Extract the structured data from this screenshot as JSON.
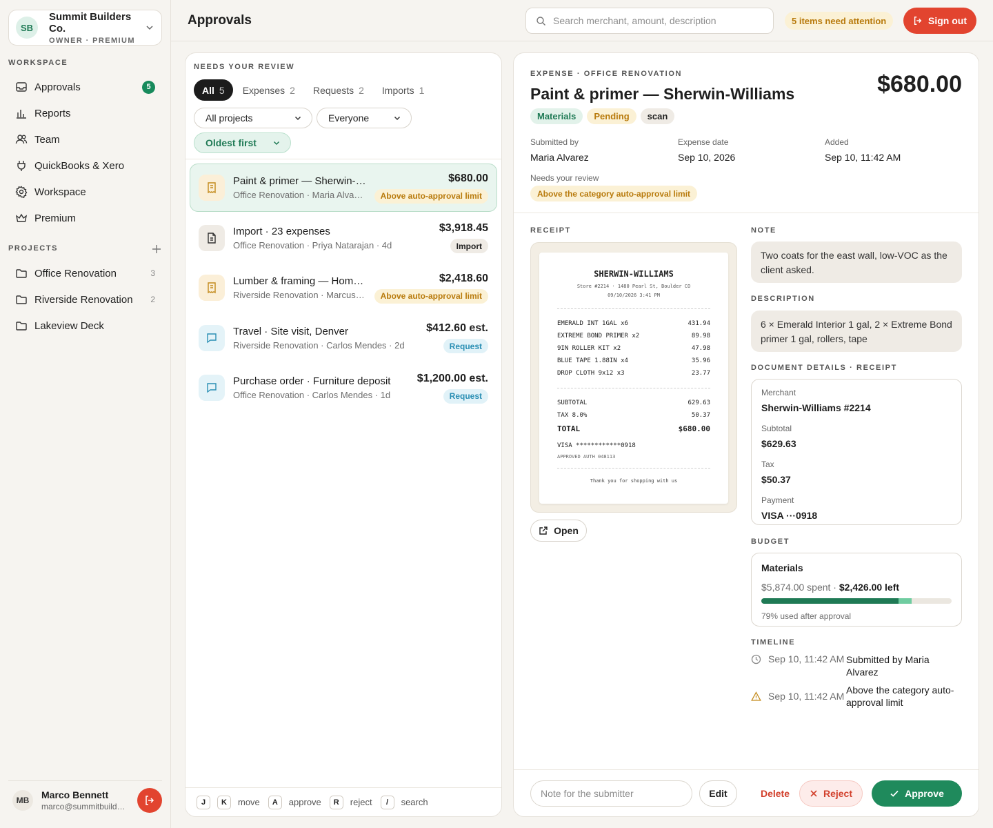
{
  "org": {
    "initials": "SB",
    "name": "Summit Builders Co.",
    "sub": "OWNER · PREMIUM"
  },
  "sidebar": {
    "workspace_label": "WORKSPACE",
    "items": [
      {
        "label": "Approvals",
        "icon": "inbox-icon",
        "badge": "5"
      },
      {
        "label": "Reports",
        "icon": "bar-chart-icon"
      },
      {
        "label": "Team",
        "icon": "users-icon"
      },
      {
        "label": "QuickBooks & Xero",
        "icon": "plug-icon"
      },
      {
        "label": "Workspace",
        "icon": "gear-icon"
      },
      {
        "label": "Premium",
        "icon": "crown-icon"
      }
    ],
    "projects_label": "PROJECTS",
    "projects": [
      {
        "label": "Office Renovation",
        "count": "3"
      },
      {
        "label": "Riverside Renovation",
        "count": "2"
      },
      {
        "label": "Lakeview Deck",
        "count": ""
      }
    ]
  },
  "user": {
    "initials": "MB",
    "name": "Marco Bennett",
    "email": "marco@summitbuilders.co"
  },
  "header": {
    "title": "Approvals",
    "search_placeholder": "Search merchant, amount, description",
    "attention": "5 items need attention",
    "signout": "Sign out"
  },
  "list": {
    "label": "NEEDS YOUR REVIEW",
    "tabs": [
      {
        "label": "All",
        "count": "5"
      },
      {
        "label": "Expenses",
        "count": "2"
      },
      {
        "label": "Requests",
        "count": "2"
      },
      {
        "label": "Imports",
        "count": "1"
      }
    ],
    "filters": {
      "project": "All projects",
      "people": "Everyone",
      "sort": "Oldest first"
    },
    "items": [
      {
        "kind": "expense",
        "title": "Paint & primer — Sherwin-Williams",
        "sub": "Office Renovation · Maria Alvarez · 1d",
        "amount": "$680.00",
        "pill": "Above auto-approval limit"
      },
      {
        "kind": "import",
        "title": "Import · 23 expenses",
        "sub": "Office Renovation · Priya Natarajan · 4d",
        "amount": "$3,918.45",
        "pill": "Import"
      },
      {
        "kind": "expense",
        "title": "Lumber & framing — Home Depot",
        "sub": "Riverside Renovation · Marcus Chen · 3d",
        "amount": "$2,418.60",
        "pill": "Above auto-approval limit"
      },
      {
        "kind": "request",
        "title": "Travel · Site visit, Denver",
        "sub": "Riverside Renovation · Carlos Mendes · 2d",
        "amount": "$412.60 est.",
        "pill": "Request"
      },
      {
        "kind": "request",
        "title": "Purchase order · Furniture deposit",
        "sub": "Office Renovation · Carlos Mendes · 1d",
        "amount": "$1,200.00 est.",
        "pill": "Request"
      }
    ],
    "shortcuts": [
      {
        "keys": [
          "J",
          "K"
        ],
        "label": "move"
      },
      {
        "keys": [
          "A"
        ],
        "label": "approve"
      },
      {
        "keys": [
          "R"
        ],
        "label": "reject"
      },
      {
        "keys": [
          "/"
        ],
        "label": "search"
      }
    ]
  },
  "detail": {
    "eyebrow": "EXPENSE · OFFICE RENOVATION",
    "title": "Paint & primer — Sherwin-Williams",
    "amount": "$680.00",
    "tags": [
      "Materials",
      "Pending",
      "scan"
    ],
    "submitted_by_label": "Submitted by",
    "submitted_by": "Maria Alvarez",
    "expense_date_label": "Expense date",
    "expense_date": "Sep 10, 2026",
    "added_label": "Added",
    "added": "Sep 10, 11:42 AM",
    "review_label": "Needs your review",
    "review_reason": "Above the category auto-approval limit",
    "receipt_label": "RECEIPT",
    "receipt": {
      "merchant": "SHERWIN-WILLIAMS",
      "store": "Store #2214 · 1480 Pearl St, Boulder CO",
      "datetime": "09/10/2026 3:41 PM",
      "lines": [
        {
          "desc": "EMERALD INT 1GAL x6",
          "amt": "431.94"
        },
        {
          "desc": "EXTREME BOND PRIMER x2",
          "amt": "89.98"
        },
        {
          "desc": "9IN ROLLER KIT x2",
          "amt": "47.98"
        },
        {
          "desc": "BLUE TAPE 1.88IN x4",
          "amt": "35.96"
        },
        {
          "desc": "DROP CLOTH 9x12 x3",
          "amt": "23.77"
        }
      ],
      "subtotal_label": "SUBTOTAL",
      "subtotal": "629.63",
      "tax_label": "TAX 8.0%",
      "tax": "50.37",
      "total_label": "TOTAL",
      "total": "$680.00",
      "card": "VISA ************0918",
      "approved": "APPROVED AUTH 048113",
      "thanks": "Thank you for shopping with us"
    },
    "open": "Open",
    "note_label": "NOTE",
    "note": "Two coats for the east wall, low-VOC as the client asked.",
    "description_label": "DESCRIPTION",
    "description": "6 × Emerald Interior 1 gal, 2 × Extreme Bond primer 1 gal, rollers, tape",
    "doc_label": "DOCUMENT DETAILS · RECEIPT",
    "doc": [
      {
        "label": "Merchant",
        "value": "Sherwin-Williams #2214"
      },
      {
        "label": "Subtotal",
        "value": "$629.63"
      },
      {
        "label": "Tax",
        "value": "$50.37"
      },
      {
        "label": "Payment",
        "value": "VISA ···0918"
      }
    ],
    "budget_label": "BUDGET",
    "budget": {
      "category": "Materials",
      "spent": "$5,874.00 spent",
      "left": "$2,426.00 left",
      "used_before_fraction": 0.72,
      "used_after_fraction": 0.79,
      "note": "79% used after approval"
    },
    "timeline_label": "TIMELINE",
    "timeline": [
      {
        "icon": "clock-icon",
        "time": "Sep 10, 11:42 AM",
        "text": "Submitted by Maria Alvarez"
      },
      {
        "icon": "warning-icon",
        "time": "Sep 10, 11:42 AM",
        "text": "Above the category auto-approval limit"
      }
    ],
    "actions": {
      "note_placeholder": "Note for the submitter",
      "edit": "Edit",
      "delete": "Delete",
      "reject": "Reject",
      "approve": "Approve"
    }
  },
  "colors": {
    "accent_green": "#1f8a5c",
    "danger_red": "#e2442f",
    "warning_amber": "#b87a0c",
    "request_blue": "#2a8fb4"
  }
}
